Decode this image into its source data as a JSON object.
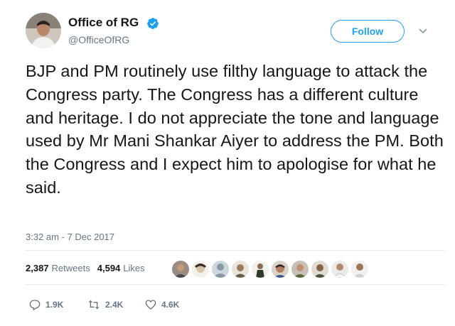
{
  "user": {
    "display_name": "Office of RG",
    "handle": "@OfficeOfRG",
    "verified": true
  },
  "follow_label": "Follow",
  "tweet": {
    "text": "BJP and PM routinely use filthy language to attack the Congress party. The Congress has a different culture and heritage. I do not appreciate the tone and language used by Mr Mani Shankar Aiyer to address the PM. Both the Congress and I expect him to apologise for what he said.",
    "timestamp": "3:32 am - 7 Dec 2017"
  },
  "stats": {
    "retweets_count": "2,387",
    "retweets_label": "Retweets",
    "likes_count": "4,594",
    "likes_label": "Likes"
  },
  "liker_avatars": [
    "avatar-1",
    "avatar-2",
    "avatar-3",
    "avatar-4",
    "avatar-5",
    "avatar-6",
    "avatar-7",
    "avatar-8",
    "avatar-9",
    "avatar-10"
  ],
  "actions": {
    "reply_count": "1.9K",
    "retweet_count": "2.4K",
    "like_count": "4.6K"
  },
  "colors": {
    "accent": "#1da1f2",
    "secondary_text": "#657786",
    "primary_text": "#14171a"
  },
  "icons": {
    "verified": "verified-badge-icon",
    "caret": "chevron-down-icon",
    "reply": "reply-icon",
    "retweet": "retweet-icon",
    "like": "heart-icon"
  }
}
